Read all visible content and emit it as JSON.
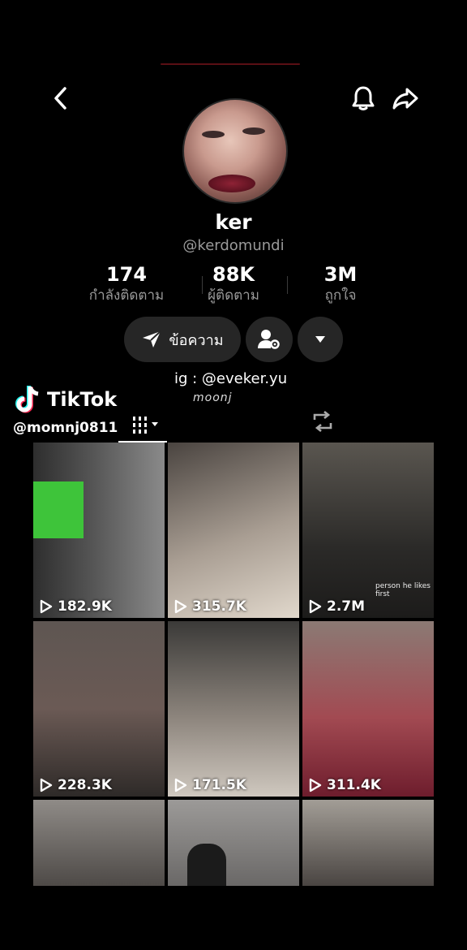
{
  "nav": {
    "back_icon": "chevron-left-icon",
    "bell_icon": "bell-icon",
    "share_icon": "share-arrow-icon"
  },
  "profile": {
    "name": "ker",
    "handle": "@kerdomundi",
    "stats": [
      {
        "value": "174",
        "label": "กำลังติดตาม"
      },
      {
        "value": "88K",
        "label": "ผู้ติดตาม"
      },
      {
        "value": "3M",
        "label": "ถูกใจ"
      }
    ],
    "message_label": "ข้อความ",
    "bio": "ig : @eveker.yu",
    "bio_scribble": "moonj"
  },
  "watermark": {
    "brand": "TikTok",
    "user": "@momnj0811"
  },
  "videos": [
    {
      "views": "182.9K",
      "bg": "#5b5b5b"
    },
    {
      "views": "315.7K",
      "bg": "#6d6257"
    },
    {
      "views": "2.7M",
      "bg": "#3d3a38"
    },
    {
      "views": "228.3K",
      "bg": "#4e4441"
    },
    {
      "views": "171.5K",
      "bg": "#5d5a55"
    },
    {
      "views": "311.4K",
      "bg": "#6a4a45"
    },
    {
      "views": "",
      "bg": "#6a6865"
    },
    {
      "views": "",
      "bg": "#7a7878"
    },
    {
      "views": "",
      "bg": "#55504c"
    }
  ],
  "overlay_text": "person he likes first"
}
